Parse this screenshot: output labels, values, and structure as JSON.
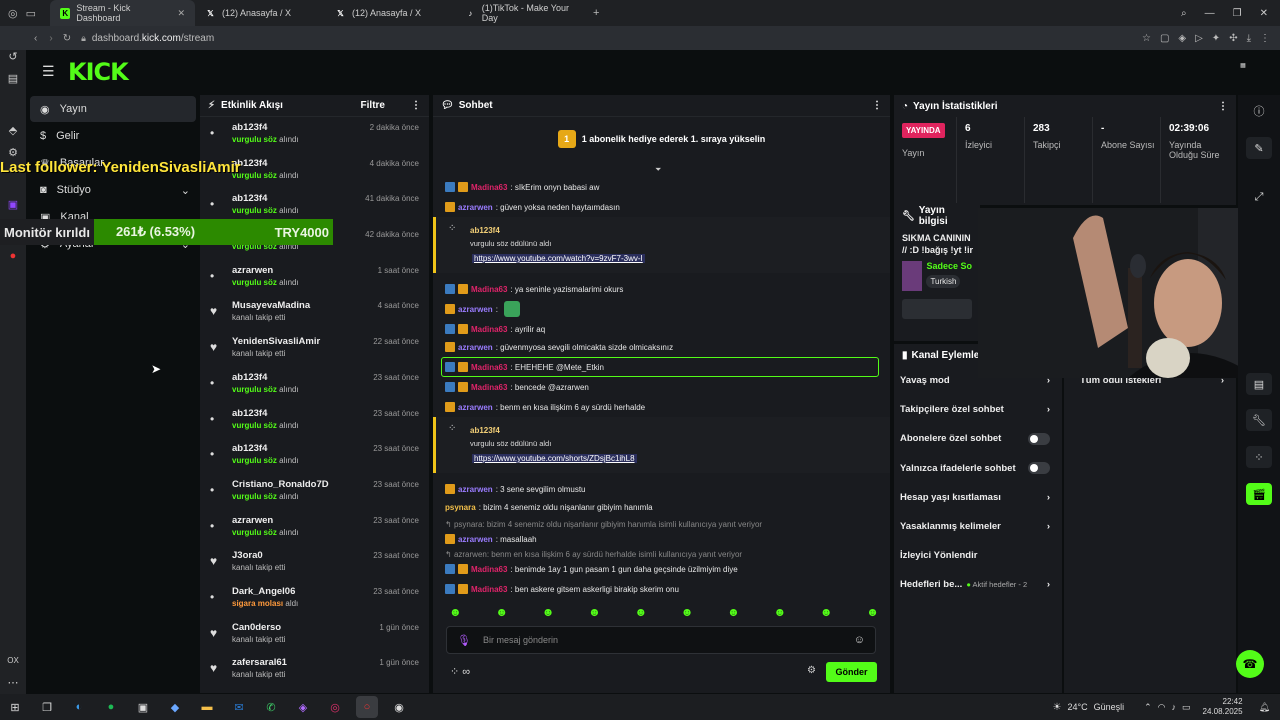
{
  "browser": {
    "tabs": [
      {
        "label": "Stream - Kick Dashboard",
        "active": true
      },
      {
        "label": "(12) Anasayfa / X"
      },
      {
        "label": "(12) Anasayfa / X"
      },
      {
        "label": "(1)TikTok - Make Your Day"
      }
    ],
    "url_prefix": "dashboard.",
    "url_domain": "kick.com",
    "url_path": "/stream"
  },
  "kick": {
    "logo": "KICK",
    "nav": [
      {
        "label": "Yayın",
        "icon": "broadcast-icon"
      },
      {
        "label": "Gelir",
        "icon": "dollar-icon"
      },
      {
        "label": "Başarılar",
        "icon": "trophy-icon"
      },
      {
        "label": "Stüdyo",
        "icon": "studio-icon"
      },
      {
        "label": "Kanal",
        "icon": "channel-icon"
      },
      {
        "label": "Ayarlar",
        "icon": "gear-icon"
      }
    ]
  },
  "overlay": {
    "last_follower": "Last follower: YenidenSivasliAmir",
    "monitor_label": "Monitör kırıldı",
    "monitor_pct": "261₺ (6.53%)",
    "monitor_goal": "TRY4000"
  },
  "activity": {
    "title": "Etkinlik Akışı",
    "filter": "Filtre",
    "items": [
      {
        "name": "ab123f4",
        "pre": "vurgulu söz",
        "post": " alındı",
        "kind": "g",
        "time": "2 dakika önce",
        "icon": "•"
      },
      {
        "name": "ab123f4",
        "pre": "vurgulu söz",
        "post": " alındı",
        "kind": "g",
        "time": "4 dakika önce",
        "icon": "•"
      },
      {
        "name": "ab123f4",
        "pre": "vurgulu söz",
        "post": " alındı",
        "kind": "g",
        "time": "41 dakika önce",
        "icon": "•"
      },
      {
        "name": "ab123f4",
        "pre": "vurgulu söz",
        "post": " alındı",
        "kind": "g",
        "time": "42 dakika önce",
        "icon": "•"
      },
      {
        "name": "azrarwen",
        "pre": "vurgulu söz",
        "post": " alındı",
        "kind": "g",
        "time": "1 saat önce",
        "icon": "•"
      },
      {
        "name": "MusayevaMadina",
        "pre": "",
        "post": "kanalı takip etti",
        "kind": "",
        "time": "4 saat önce",
        "icon": "♥"
      },
      {
        "name": "YenidenSivasliAmir",
        "pre": "",
        "post": "kanalı takip etti",
        "kind": "",
        "time": "22 saat önce",
        "icon": "♥"
      },
      {
        "name": "ab123f4",
        "pre": "vurgulu söz",
        "post": " alındı",
        "kind": "g",
        "time": "23 saat önce",
        "icon": "•"
      },
      {
        "name": "ab123f4",
        "pre": "vurgulu söz",
        "post": " alındı",
        "kind": "g",
        "time": "23 saat önce",
        "icon": "•"
      },
      {
        "name": "ab123f4",
        "pre": "vurgulu söz",
        "post": " alındı",
        "kind": "g",
        "time": "23 saat önce",
        "icon": "•"
      },
      {
        "name": "Cristiano_Ronaldo7D",
        "pre": "vurgulu söz",
        "post": " alındı",
        "kind": "g",
        "time": "23 saat önce",
        "icon": "•"
      },
      {
        "name": "azrarwen",
        "pre": "vurgulu söz",
        "post": " alındı",
        "kind": "g",
        "time": "23 saat önce",
        "icon": "•"
      },
      {
        "name": "J3ora0",
        "pre": "",
        "post": "kanalı takip etti",
        "kind": "",
        "time": "23 saat önce",
        "icon": "♥"
      },
      {
        "name": "Dark_Angel06",
        "pre": "sigara molası",
        "post": " aldı",
        "kind": "o",
        "time": "23 saat önce",
        "icon": "•"
      },
      {
        "name": "Can0derso",
        "pre": "",
        "post": "kanalı takip etti",
        "kind": "",
        "time": "1 gün önce",
        "icon": "♥"
      },
      {
        "name": "zafersaral61",
        "pre": "",
        "post": "kanalı takip etti",
        "kind": "",
        "time": "1 gün önce",
        "icon": "♥"
      }
    ]
  },
  "chat": {
    "title": "Sohbet",
    "gift_banner": "1 abonelik hediye ederek 1. sıraya yükselin",
    "messages": [
      {
        "user": "Madina63",
        "cls": "u-m",
        "badges": 2,
        "text": ": sIkErim onyn babasi aw"
      },
      {
        "user": "azrarwen",
        "cls": "u-a",
        "badges": 1,
        "text": ": güven yoksa neden haytaımdasın"
      },
      {
        "user": "Madina63",
        "cls": "u-m",
        "badges": 2,
        "text": ": ya seninle yazismalarimi okurs"
      },
      {
        "user": "azrarwen",
        "cls": "u-a",
        "badges": 1,
        "text": ":"
      },
      {
        "user": "Madina63",
        "cls": "u-m",
        "badges": 2,
        "text": ": ayrilir aq"
      },
      {
        "user": "azrarwen",
        "cls": "u-a",
        "badges": 1,
        "text": ": güvenmyosa sevgili olmicakta sizde olmicaksınız"
      },
      {
        "user": "Madina63",
        "cls": "u-m",
        "badges": 2,
        "text": ": EHEHEHE @Mete_Etkin"
      },
      {
        "user": "Madina63",
        "cls": "u-m",
        "badges": 2,
        "text": ": bencede @azrarwen"
      },
      {
        "user": "azrarwen",
        "cls": "u-a",
        "badges": 1,
        "text": ": benm en kısa ilişkim 6 ay sürdü herhalde"
      },
      {
        "user": "azrarwen",
        "cls": "u-a",
        "badges": 1,
        "text": ": 3 sene sevgilim olmustu"
      },
      {
        "user": "psynara",
        "cls": "u-p",
        "badges": 0,
        "text": ": bizim 4 senemiz oldu nişanlanır gibiyim hanımla"
      },
      {
        "reply": "psynara: bizim 4 senemiz oldu nişanlanır gibiyim hanımla isimli kullanıcıya yanıt veriyor"
      },
      {
        "user": "azrarwen",
        "cls": "u-a",
        "badges": 1,
        "text": ": masallaah"
      },
      {
        "reply": "azrarwen: benm en kısa ilişkim 6 ay sürdü herhalde isimli kullanıcıya yanıt veriyor"
      },
      {
        "user": "Madina63",
        "cls": "u-m",
        "badges": 2,
        "text": ": benimde 1ay 1 gun pasam 1 gun daha geçsinde üzilmiyim diye"
      },
      {
        "user": "Madina63",
        "cls": "u-m",
        "badges": 2,
        "text": ": ben askere gitsem askerligi birakip skerim onu"
      }
    ],
    "gifts": [
      {
        "name": "ab123f4",
        "sub": "vurgulu söz ödülünü aldı",
        "link": "https://www.youtube.com/watch?v=9zvF7-3wv-I"
      },
      {
        "name": "ab123f4",
        "sub": "vurgulu söz ödülünü aldı",
        "link": "https://www.youtube.com/shorts/ZDsjBc1ihL8"
      }
    ],
    "input_placeholder": "Bir mesaj gönderin",
    "send": "Gönder"
  },
  "stats": {
    "title": "Yayın İstatistikleri",
    "live_badge": "YAYINDA",
    "live_label": "Yayın",
    "items": [
      {
        "value": "6",
        "label": "İzleyici"
      },
      {
        "value": "283",
        "label": "Takipçi"
      },
      {
        "value": "-",
        "label": "Abone Sayısı"
      },
      {
        "value": "02:39:06",
        "label": "Yayında Olduğu Süre"
      }
    ]
  },
  "info": {
    "title": "Yayın bilgisi",
    "line1": "SIKMA CANININ",
    "line2": "// :D !bağış !yt !ir",
    "category": "Sadece So",
    "lang": "Turkish"
  },
  "actions": {
    "title": "Kanal Eylemleri",
    "items": [
      {
        "label": "Yavaş mod",
        "ctl": "chevron"
      },
      {
        "label": "Takipçilere özel sohbet",
        "ctl": "chevron"
      },
      {
        "label": "Abonelere özel sohbet",
        "ctl": "toggle"
      },
      {
        "label": "Yalnızca ifadelerle sohbet",
        "ctl": "toggle"
      },
      {
        "label": "Hesap yaşı kısıtlaması",
        "ctl": "chevron"
      },
      {
        "label": "Yasaklanmış kelimeler",
        "ctl": "chevron"
      },
      {
        "label": "İzleyici Yönlendir",
        "ctl": ""
      },
      {
        "label": "Hedefleri be...",
        "ctl": "chevron",
        "extra": "Aktif hedefler - 2"
      }
    ]
  },
  "rewards": {
    "label": "Tüm ödül istekleri"
  },
  "taskbar": {
    "weather": "24°C",
    "weather_desc": "Güneşli",
    "time": "22:42",
    "date": "24.08.2025"
  },
  "colors": {
    "kick_green": "#53fc18",
    "live_red": "#e0245e"
  }
}
